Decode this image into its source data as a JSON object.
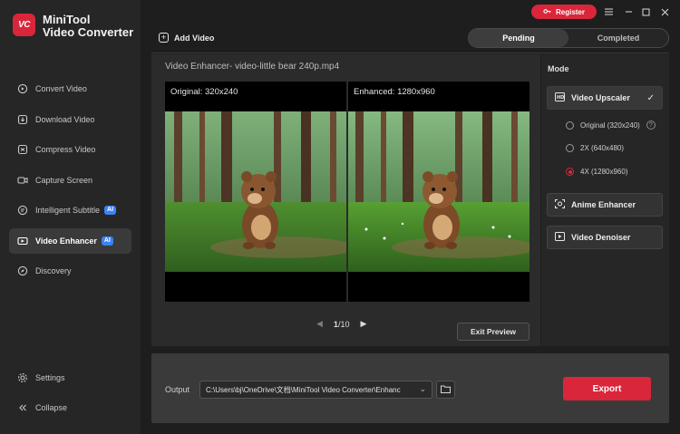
{
  "app": {
    "logo_text": "VC",
    "title_line1": "MiniTool",
    "title_line2": "Video Converter"
  },
  "sidebar": {
    "items": [
      {
        "label": "Convert Video",
        "icon": "convert-icon"
      },
      {
        "label": "Download Video",
        "icon": "download-icon"
      },
      {
        "label": "Compress Video",
        "icon": "compress-icon"
      },
      {
        "label": "Capture Screen",
        "icon": "record-icon"
      },
      {
        "label": "Intelligent Subtitle",
        "icon": "subtitle-icon",
        "badge": "AI"
      },
      {
        "label": "Video Enhancer",
        "icon": "enhance-icon",
        "badge": "AI",
        "active": true
      },
      {
        "label": "Discovery",
        "icon": "compass-icon"
      }
    ],
    "settings_label": "Settings",
    "collapse_label": "Collapse"
  },
  "topbar": {
    "register_label": "Register",
    "add_video_label": "Add Video",
    "tabs": [
      {
        "label": "Pending",
        "active": true
      },
      {
        "label": "Completed"
      }
    ]
  },
  "preview": {
    "title": "Video Enhancer- video-little bear 240p.mp4",
    "original_label": "Original: 320x240",
    "enhanced_label": "Enhanced: 1280x960",
    "page_current": "1",
    "page_total": "/10",
    "exit_label": "Exit Preview"
  },
  "mode": {
    "title": "Mode",
    "upscaler_label": "Video Upscaler",
    "options": [
      {
        "label": "Original (320x240)",
        "selected": false,
        "help": true
      },
      {
        "label": "2X (640x480)",
        "selected": false
      },
      {
        "label": "4X (1280x960)",
        "selected": true
      }
    ],
    "anime_label": "Anime Enhancer",
    "denoiser_label": "Video Denoiser"
  },
  "output": {
    "label": "Output",
    "path": "C:\\Users\\bj\\OneDrive\\文档\\MiniTool Video Converter\\Enhanc",
    "export_label": "Export"
  },
  "colors": {
    "accent": "#d9263b",
    "ai_badge": "#3b82f6",
    "bg": "#1e1e1e"
  }
}
